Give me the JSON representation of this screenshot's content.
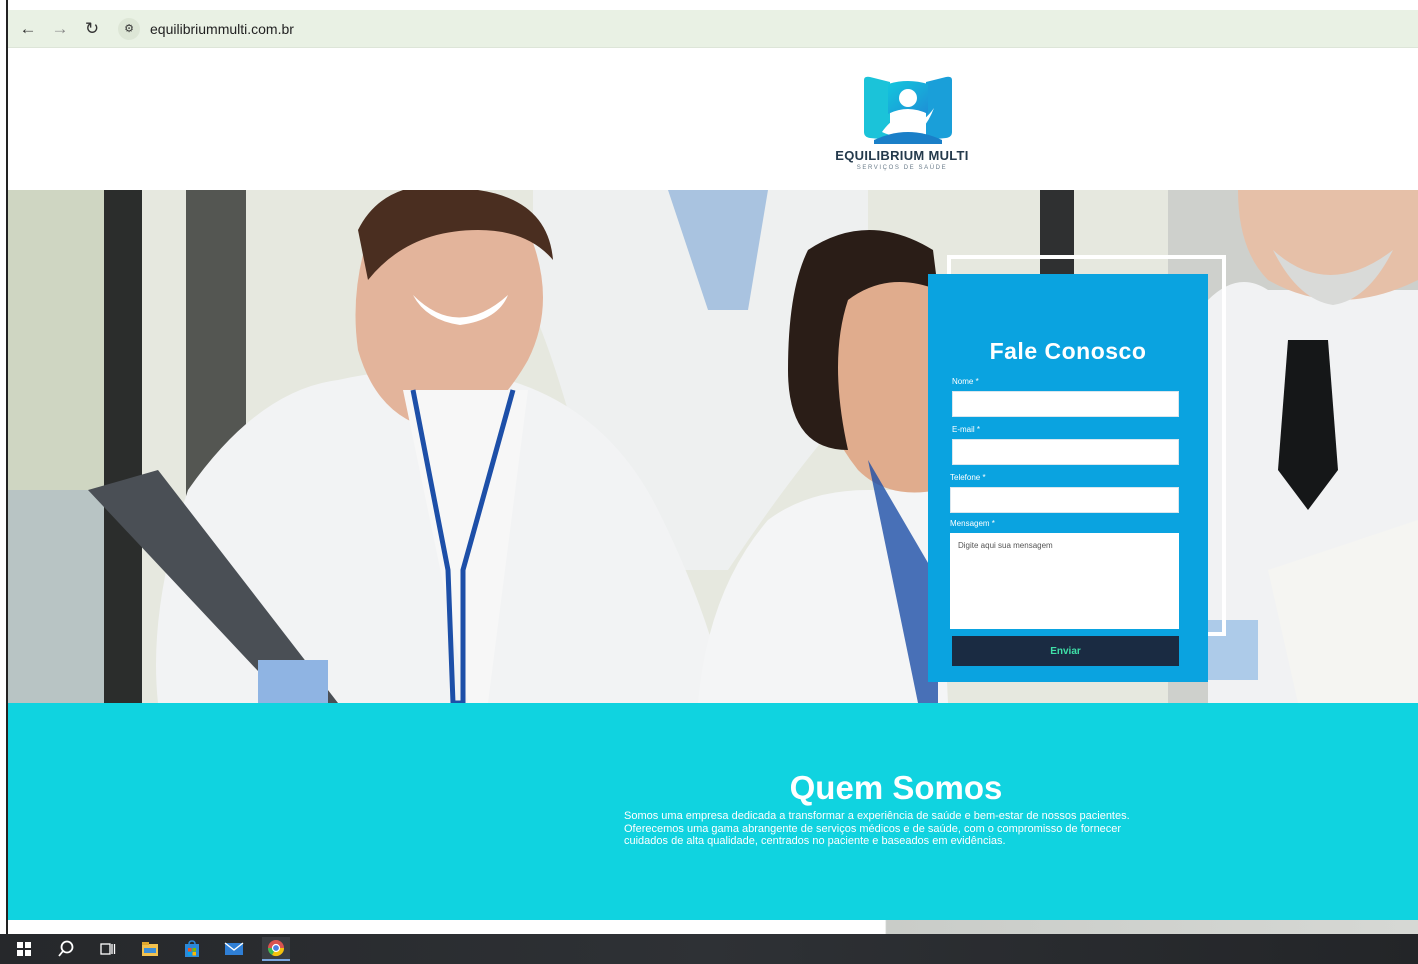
{
  "browser": {
    "url": "equilibriummulti.com.br"
  },
  "logo": {
    "name": "EQUILIBRIUM MULTI",
    "subtitle": "SERVIÇOS DE SAÚDE"
  },
  "contact_form": {
    "title": "Fale Conosco",
    "name_label": "Nome *",
    "email_label": "E-mail *",
    "phone_label": "Telefone *",
    "message_label": "Mensagem *",
    "message_placeholder": "Digite aqui sua mensagem",
    "submit_label": "Enviar"
  },
  "about": {
    "title": "Quem Somos",
    "text": "Somos uma empresa dedicada a transformar a experiência de saúde e bem-estar de nossos pacientes. Oferecemos uma gama abrangente de serviços médicos e de saúde, com o compromisso de fornecer cuidados de alta qualidade, centrados no paciente e baseados em evidências."
  },
  "colors": {
    "url_bar": "#e9f1e4",
    "form_background": "#0aa3e0",
    "submit_button": "#1a2b42",
    "submit_text": "#3fe0a8",
    "about_background": "#10d3e0",
    "logo_text": "#243a4c"
  },
  "taskbar": {
    "icons": [
      "windows-start-icon",
      "search-icon",
      "task-view-icon",
      "file-explorer-icon",
      "store-icon",
      "mail-icon",
      "chrome-icon"
    ]
  }
}
